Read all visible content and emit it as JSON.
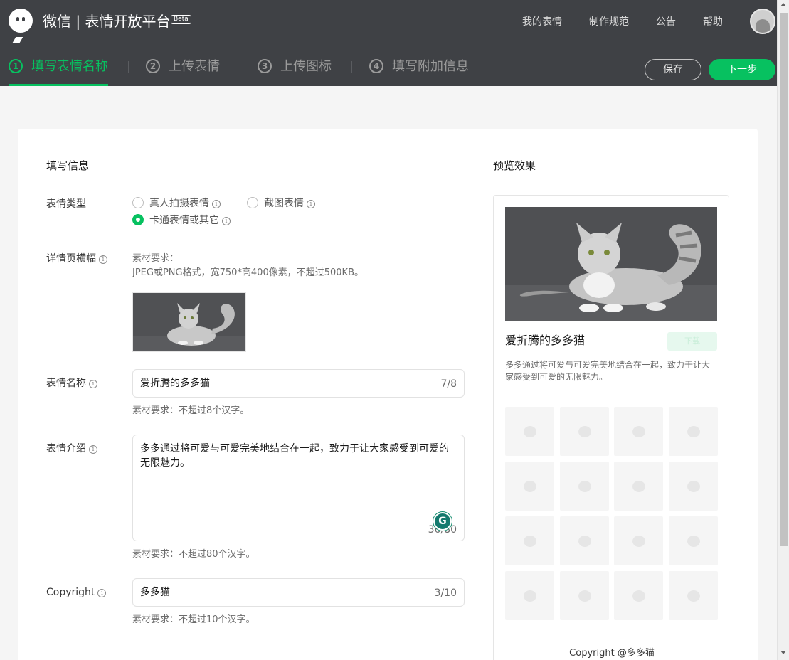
{
  "header": {
    "brand": "微信 | 表情开放平台",
    "beta": "Beta",
    "nav": [
      "我的表情",
      "制作规范",
      "公告",
      "帮助"
    ]
  },
  "steps": [
    {
      "num": "1",
      "label": "填写表情名称",
      "active": true
    },
    {
      "num": "2",
      "label": "上传表情",
      "active": false
    },
    {
      "num": "3",
      "label": "上传图标",
      "active": false
    },
    {
      "num": "4",
      "label": "填写附加信息",
      "active": false
    }
  ],
  "actions": {
    "save": "保存",
    "next": "下一步"
  },
  "form": {
    "section_title": "填写信息",
    "type": {
      "label": "表情类型",
      "options": [
        "真人拍摄表情",
        "截图表情",
        "卡通表情或其它"
      ],
      "selected": "卡通表情或其它"
    },
    "banner": {
      "label": "详情页横幅",
      "hint_title": "素材要求：",
      "hint": "JPEG或PNG格式，宽750*高400像素，不超过500KB。"
    },
    "name": {
      "label": "表情名称",
      "value": "爱折腾的多多猫",
      "count": "7/8",
      "hint": "素材要求：不超过8个汉字。"
    },
    "intro": {
      "label": "表情介绍",
      "value": "多多通过将可爱与可爱完美地结合在一起，致力于让大家感受到可爱的无限魅力。",
      "count": "36/80",
      "hint": "素材要求：不超过80个汉字。"
    },
    "copyright": {
      "label": "Copyright",
      "value": "多多猫",
      "count": "3/10",
      "hint": "素材要求：不超过10个汉字。"
    }
  },
  "preview": {
    "section_title": "预览效果",
    "title": "爱折腾的多多猫",
    "download": "下载",
    "desc": "多多通过将可爱与可爱完美地结合在一起，致力于让大家感受到可爱的无限魅力。",
    "copyright": "Copyright @多多猫",
    "grid_count": 16
  },
  "colors": {
    "accent": "#07c160",
    "header_bg": "#3f4145"
  }
}
